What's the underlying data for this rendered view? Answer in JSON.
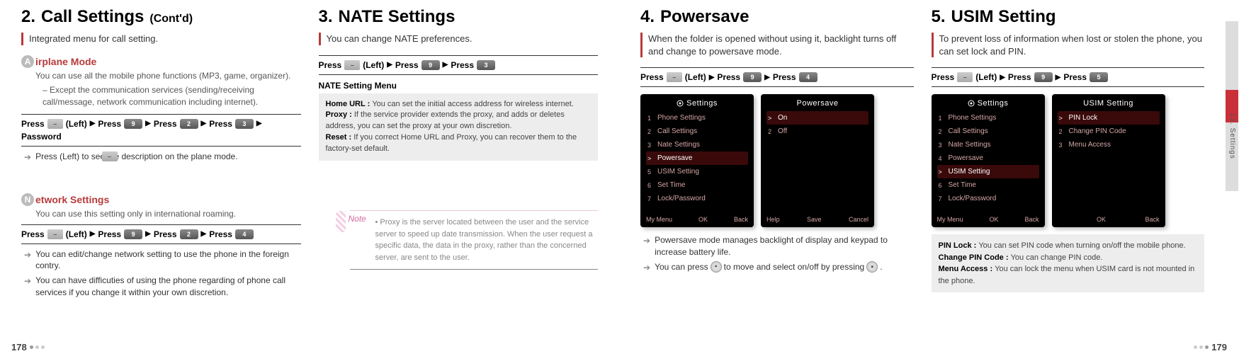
{
  "page_left_num": "178",
  "page_right_num": "179",
  "side_label": "12. Settings",
  "s2": {
    "num": "2.",
    "title": "Call Settings",
    "contd": "(Cont'd)",
    "lead": "Integrated menu for call setting.",
    "airplane": {
      "badge": "A",
      "title": "irplane Mode",
      "desc1": "You can use all the mobile phone functions (MP3, game, organizer).",
      "desc2": "– Except the communication services (sending/receiving call/message, network communication including internet).",
      "press_prefix": "Press",
      "left": "(Left)",
      "k9": "9",
      "k2": "2",
      "k3": "3",
      "password": "Password",
      "bullet": "Press           (Left) to see the description on the plane mode."
    },
    "network": {
      "badge": "N",
      "title": "etwork Settings",
      "desc": "You can use this setting only in international roaming.",
      "press_prefix": "Press",
      "left": "(Left)",
      "k9": "9",
      "k2": "2",
      "k4": "4",
      "b1": "You can edit/change network setting to use the phone in the foreign contry.",
      "b2": "You can have difficuties of using the phone regarding of phone call services if you change it within your own discretion."
    }
  },
  "s3": {
    "num": "3.",
    "title": "NATE Settings",
    "lead": "You can change NATE preferences.",
    "press_prefix": "Press",
    "left": "(Left)",
    "k9": "9",
    "k3": "3",
    "menu_head": "NATE Setting Menu",
    "box": {
      "l1b": "Home URL :",
      "l1": "You can set the initial access address for wireless internet.",
      "l2b": "Proxy :",
      "l2": "If the service provider extends the proxy, and adds or deletes address, you can set the proxy at your own discretion.",
      "l3b": "Reset :",
      "l3": "If you correct Home URL and Proxy, you can recover them to the factory-set default."
    },
    "note_label": "Note",
    "note": "• Proxy is the server located between the user and the service server to speed up date transmission. When the user request a specific data, the data in the proxy, rather than the concerned server, are sent to the user."
  },
  "s4": {
    "num": "4.",
    "title": "Powersave",
    "lead": "When the folder is opened without using it, backlight turns off and change to powersave mode.",
    "press_prefix": "Press",
    "left": "(Left)",
    "k9": "9",
    "k4": "4",
    "screen1": {
      "title": "Settings",
      "items": [
        "Phone Settings",
        "Call Settings",
        "Nate Settings",
        "Powersave",
        "USIM Setting",
        "Set Time",
        "Lock/Password"
      ],
      "sel": 3,
      "ft": [
        "My Menu",
        "OK",
        "Back"
      ]
    },
    "screen2": {
      "title": "Powersave",
      "items": [
        "On",
        "Off"
      ],
      "sel": 0,
      "ft": [
        "Help",
        "Save",
        "Cancel"
      ]
    },
    "b1": "Powersave mode manages backlight of display and keypad to increase battery life.",
    "b2a": "You can press ",
    "b2b": " to move and select on/off by pressing ",
    "b2c": " ."
  },
  "s5": {
    "num": "5.",
    "title": "USIM Setting",
    "lead": "To prevent loss of information when lost or stolen the phone, you can set lock and PIN.",
    "press_prefix": "Press",
    "left": "(Left)",
    "k9": "9",
    "k5": "5",
    "screen1": {
      "title": "Settings",
      "items": [
        "Phone Settings",
        "Call Settings",
        "Nate Settings",
        "Powersave",
        "USIM Setting",
        "Set Time",
        "Lock/Password"
      ],
      "sel": 4,
      "ft": [
        "My Menu",
        "OK",
        "Back"
      ]
    },
    "screen2": {
      "title": "USIM Setting",
      "items": [
        "PIN Lock",
        "Change PIN Code",
        "Menu Access"
      ],
      "sel": 0,
      "ft": [
        "",
        "OK",
        "Back"
      ]
    },
    "box": {
      "l1b": "PIN Lock :",
      "l1": "You can set PIN code when turning on/off the mobile phone.",
      "l2b": "Change PIN Code :",
      "l2": "You can change PIN code.",
      "l3b": "Menu Access :",
      "l3": "You can lock the menu when USIM card is not mounted in the phone."
    }
  }
}
